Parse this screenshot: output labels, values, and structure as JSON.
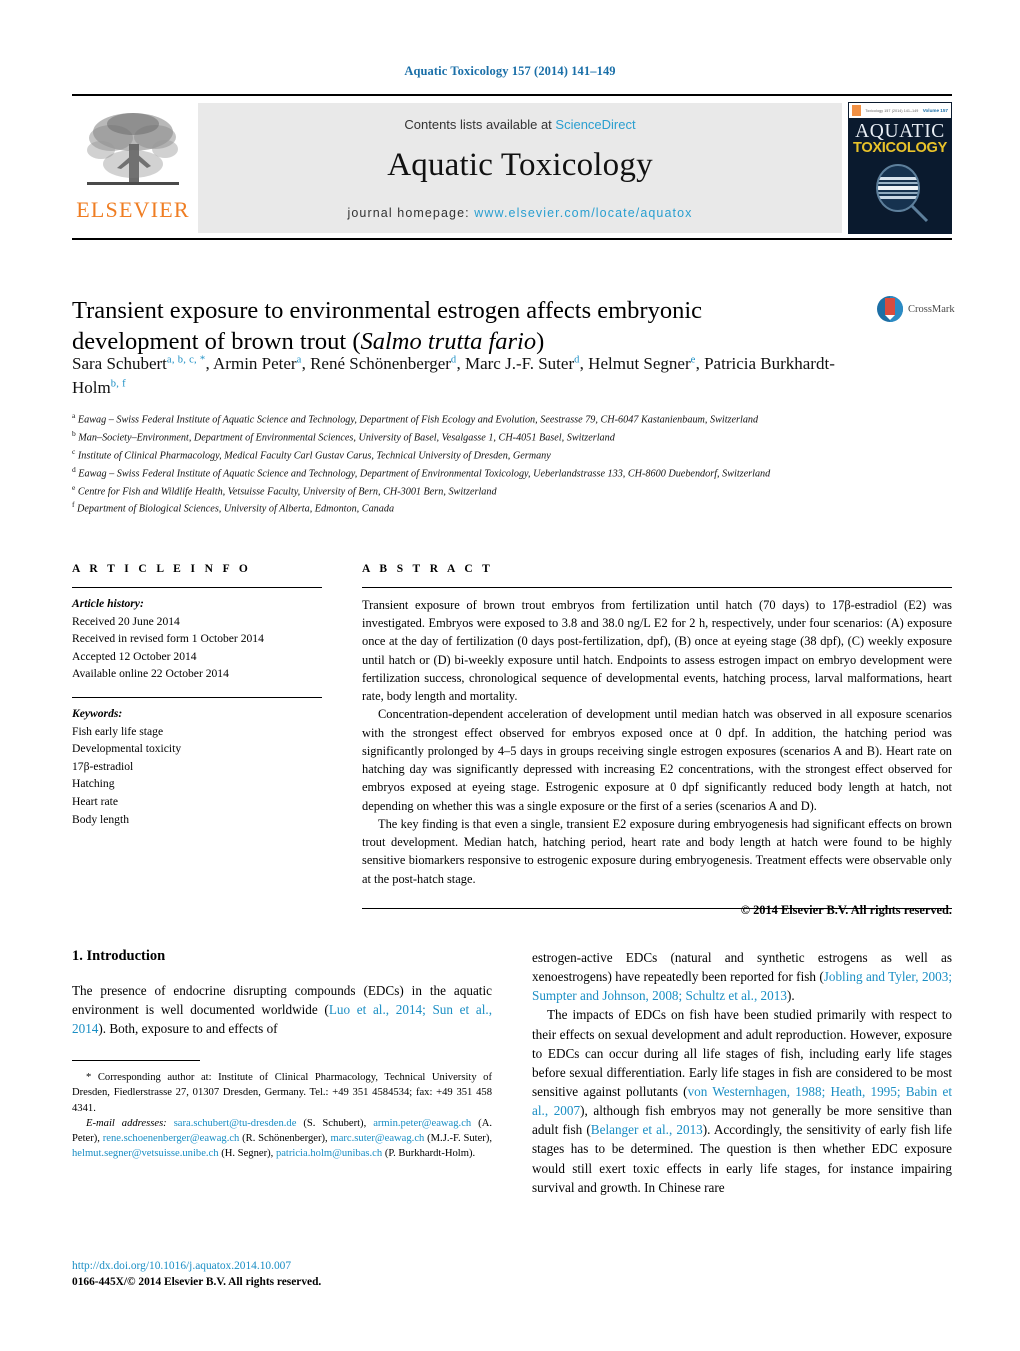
{
  "running_head": "Aquatic Toxicology 157 (2014) 141–149",
  "masthead": {
    "publisher_wordmark": "ELSEVIER",
    "contents_prefix": "Contents lists available at ",
    "contents_link": "ScienceDirect",
    "journal_name": "Aquatic Toxicology",
    "homepage_prefix": "journal homepage: ",
    "homepage_url": "www.elsevier.com/locate/aquatox",
    "cover": {
      "line1": "AQUATIC",
      "line2": "TOXICOLOGY",
      "top_mid": "Toxicology 157 (2014) 141–149",
      "top_right": "Volume 157"
    }
  },
  "crossmark": {
    "label": "CrossMark"
  },
  "article": {
    "title_line1": "Transient exposure to environmental estrogen affects embryonic",
    "title_line2_plain": "development of brown trout (",
    "title_line2_italic": "Salmo trutta fario",
    "title_line2_close": ")",
    "authors": [
      {
        "name": "Sara Schubert",
        "sup": "a, b, c, *"
      },
      {
        "name": "Armin Peter",
        "sup": "a"
      },
      {
        "name": "René Schönenberger",
        "sup": "d"
      },
      {
        "name": "Marc J.-F. Suter",
        "sup": "d"
      },
      {
        "name": "Helmut Segner",
        "sup": "e"
      },
      {
        "name": "Patricia Burkhardt-Holm",
        "sup": "b, f"
      }
    ],
    "affiliations": [
      {
        "mark": "a",
        "text": "Eawag – Swiss Federal Institute of Aquatic Science and Technology, Department of Fish Ecology and Evolution, Seestrasse 79, CH-6047 Kastanienbaum, Switzerland"
      },
      {
        "mark": "b",
        "text": "Man–Society–Environment, Department of Environmental Sciences, University of Basel, Vesalgasse 1, CH-4051 Basel, Switzerland"
      },
      {
        "mark": "c",
        "text": "Institute of Clinical Pharmacology, Medical Faculty Carl Gustav Carus, Technical University of Dresden, Germany"
      },
      {
        "mark": "d",
        "text": "Eawag – Swiss Federal Institute of Aquatic Science and Technology, Department of Environmental Toxicology, Ueberlandstrasse 133, CH-8600 Duebendorf, Switzerland"
      },
      {
        "mark": "e",
        "text": "Centre for Fish and Wildlife Health, Vetsuisse Faculty, University of Bern, CH-3001 Bern, Switzerland"
      },
      {
        "mark": "f",
        "text": "Department of Biological Sciences, University of Alberta, Edmonton, Canada"
      }
    ]
  },
  "article_info": {
    "heading": "A R T I C L E   I N F O",
    "history_label": "Article history:",
    "history": [
      "Received 20 June 2014",
      "Received in revised form 1 October 2014",
      "Accepted 12 October 2014",
      "Available online 22 October 2014"
    ],
    "keywords_label": "Keywords:",
    "keywords": [
      "Fish early life stage",
      "Developmental toxicity",
      "17β-estradiol",
      "Hatching",
      "Heart rate",
      "Body length"
    ]
  },
  "abstract": {
    "heading": "A B S T R A C T",
    "paragraphs": [
      "Transient exposure of brown trout embryos from fertilization until hatch (70 days) to 17β-estradiol (E2) was investigated. Embryos were exposed to 3.8 and 38.0 ng/L E2 for 2 h, respectively, under four scenarios: (A) exposure once at the day of fertilization (0 days post-fertilization, dpf), (B) once at eyeing stage (38 dpf), (C) weekly exposure until hatch or (D) bi-weekly exposure until hatch. Endpoints to assess estrogen impact on embryo development were fertilization success, chronological sequence of developmental events, hatching process, larval malformations, heart rate, body length and mortality.",
      "Concentration-dependent acceleration of development until median hatch was observed in all exposure scenarios with the strongest effect observed for embryos exposed once at 0 dpf. In addition, the hatching period was significantly prolonged by 4–5 days in groups receiving single estrogen exposures (scenarios A and B). Heart rate on hatching day was significantly depressed with increasing E2 concentrations, with the strongest effect observed for embryos exposed at eyeing stage. Estrogenic exposure at 0 dpf significantly reduced body length at hatch, not depending on whether this was a single exposure or the first of a series (scenarios A and D).",
      "The key finding is that even a single, transient E2 exposure during embryogenesis had significant effects on brown trout development. Median hatch, hatching period, heart rate and body length at hatch were found to be highly sensitive biomarkers responsive to estrogenic exposure during embryogenesis. Treatment effects were observable only at the post-hatch stage."
    ],
    "copyright": "© 2014 Elsevier B.V. All rights reserved."
  },
  "introduction": {
    "heading": "1.  Introduction",
    "left_p1_a": "The presence of endocrine disrupting compounds (EDCs) in the aquatic environment is well documented worldwide (",
    "left_p1_cite": "Luo et al., 2014; Sun et al., 2014",
    "left_p1_b": "). Both, exposure to and effects of",
    "right_p1_a": "estrogen-active EDCs (natural and synthetic estrogens as well as xenoestrogens) have repeatedly been reported for fish (",
    "right_p1_cite": "Jobling and Tyler, 2003; Sumpter and Johnson, 2008; Schultz et al., 2013",
    "right_p1_b": ").",
    "right_p2_a": "The impacts of EDCs on fish have been studied primarily with respect to their effects on sexual development and adult reproduction. However, exposure to EDCs can occur during all life stages of fish, including early life stages before sexual differentiation. Early life stages in fish are considered to be most sensitive against pollutants (",
    "right_p2_cite1": "von Westernhagen, 1988; Heath, 1995; Babin et al., 2007",
    "right_p2_b": "), although fish embryos may not generally be more sensitive than adult fish (",
    "right_p2_cite2": "Belanger et al., 2013",
    "right_p2_c": "). Accordingly, the sensitivity of early fish life stages has to be determined. The question is then whether EDC exposure would still exert toxic effects in early life stages, for instance impairing survival and growth. In Chinese rare"
  },
  "footnotes": {
    "corresponding": "* Corresponding author at: Institute of Clinical Pharmacology, Technical University of Dresden, Fiedlerstrasse 27, 01307 Dresden, Germany. Tel.: +49 351 4584534; fax: +49 351 458 4341.",
    "email_label": "E-mail addresses:",
    "emails": [
      {
        "addr": "sara.schubert@tu-dresden.de",
        "who": " (S. Schubert),"
      },
      {
        "addr": "armin.peter@eawag.ch",
        "who": " (A. Peter),"
      },
      {
        "addr": "rene.schoenenberger@eawag.ch",
        "who": " (R. Schönenberger),"
      },
      {
        "addr": "marc.suter@eawag.ch",
        "who": " (M.J.-F. Suter),"
      },
      {
        "addr": "helmut.segner@vetsuisse.unibe.ch",
        "who": " (H. Segner),"
      },
      {
        "addr": "patricia.holm@unibas.ch",
        "who": " (P. Burkhardt-Holm)."
      }
    ]
  },
  "doi_block": {
    "doi": "http://dx.doi.org/10.1016/j.aquatox.2014.10.007",
    "issn": "0166-445X/© 2014 Elsevier B.V. All rights reserved."
  },
  "colors": {
    "link_blue": "#1a8ec4",
    "head_blue": "#1a6fa8",
    "elsevier_orange": "#ef7d22",
    "cover_navy": "#0a1a2e",
    "cover_yellow": "#e8c22a",
    "band_gray": "#e9e9e9"
  }
}
